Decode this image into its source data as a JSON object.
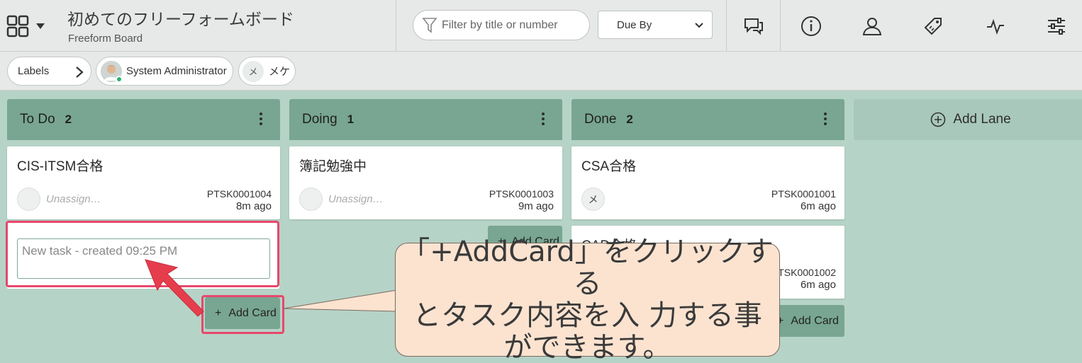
{
  "header": {
    "title": "初めてのフリーフォームボード",
    "subtitle": "Freeform Board",
    "filter_placeholder": "Filter by title or number",
    "sort_selected": "Due By"
  },
  "filterbar": {
    "labels_pill": "Labels",
    "user_pill": "System Administrator",
    "member_pill": "メケ",
    "member_initial": "メ"
  },
  "lanes": [
    {
      "name": "To Do",
      "count": "2",
      "cards": [
        {
          "title": "CIS-ITSM合格",
          "assignee": "Unassign…",
          "number": "PTSK0001004",
          "age": "8m ago"
        }
      ]
    },
    {
      "name": "Doing",
      "count": "1",
      "cards": [
        {
          "title": "簿記勉強中",
          "assignee": "Unassign…",
          "number": "PTSK0001003",
          "age": "9m ago"
        }
      ]
    },
    {
      "name": "Done",
      "count": "2",
      "cards": [
        {
          "title": "CSA合格",
          "assignee_initial": "メ",
          "number": "PTSK0001001",
          "age": "6m ago"
        },
        {
          "title": "CAD合格",
          "number": "PTSK0001002",
          "age": "6m ago"
        }
      ]
    }
  ],
  "add_lane_label": "Add Lane",
  "add_card_label": "Add Card",
  "new_task_placeholder": "New task - created 09:25 PM",
  "callout_text": [
    "「+AddCard」をクリックする",
    "とタスク内容を入 力する事",
    "ができます。"
  ],
  "colors": {
    "lane_header": "#78a693",
    "board_bg": "#b6d3c7",
    "highlight": "#e8476c",
    "callout_bg": "#fbe3d0"
  }
}
